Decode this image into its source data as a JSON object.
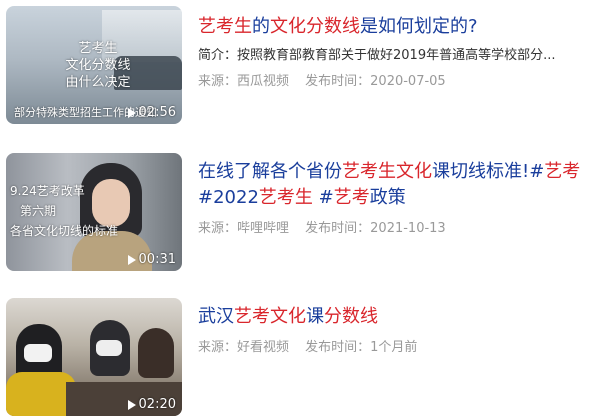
{
  "results": [
    {
      "thumb_text": [
        "艺考生",
        "文化分数线",
        "由什么决定"
      ],
      "thumb_caption": "部分特殊类型招生工作的通知",
      "duration": "02:56",
      "title_parts": [
        {
          "text": "艺考生",
          "hl": true
        },
        {
          "text": "的",
          "hl": false
        },
        {
          "text": "文化分数线",
          "hl": true
        },
        {
          "text": "是如何划定的?",
          "hl": false
        }
      ],
      "summary": "简介：按照教育部教育部关于做好2019年普通高等学校部分...",
      "source": "来源：西瓜视频",
      "date": "发布时间：2020-07-05"
    },
    {
      "thumb_text": [
        "9.24艺考改革",
        "第六期",
        "各省文化切线的标准"
      ],
      "duration": "00:31",
      "title_parts": [
        {
          "text": "在线了解各个省份",
          "hl": false
        },
        {
          "text": "艺考生文化",
          "hl": true
        },
        {
          "text": "课切线标准!#",
          "hl": false
        },
        {
          "text": "艺考",
          "hl": true
        },
        {
          "text": " #2022",
          "hl": false
        },
        {
          "text": "艺考生",
          "hl": true
        },
        {
          "text": " #",
          "hl": false
        },
        {
          "text": "艺考",
          "hl": true
        },
        {
          "text": "政策",
          "hl": false
        }
      ],
      "source": "来源：哔哩哔哩",
      "date": "发布时间：2021-10-13"
    },
    {
      "duration": "02:20",
      "title_parts": [
        {
          "text": "武汉",
          "hl": false
        },
        {
          "text": "艺考文化",
          "hl": true
        },
        {
          "text": "课",
          "hl": false
        },
        {
          "text": "分数线",
          "hl": true
        }
      ],
      "source": "来源：好看视频",
      "date": "发布时间：1个月前"
    }
  ]
}
